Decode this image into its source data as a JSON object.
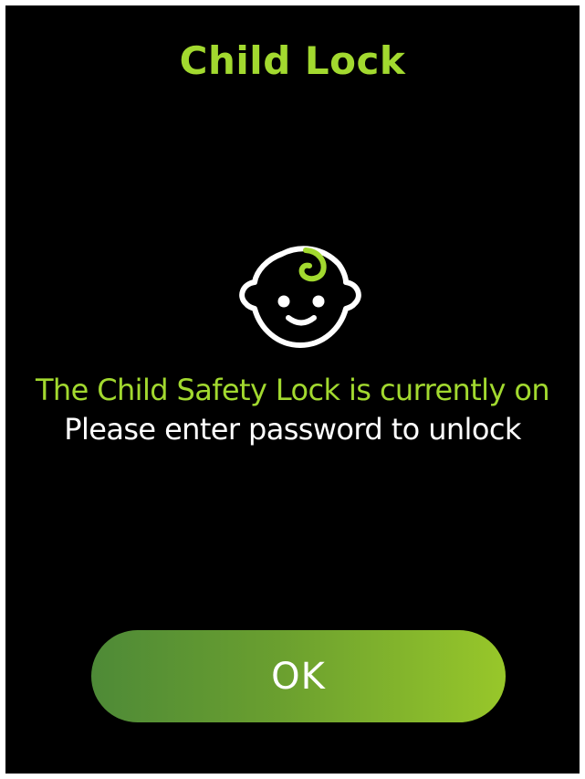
{
  "screen": {
    "title": "Child Lock",
    "status_text": "The Child Safety Lock is currently on",
    "prompt_text": "Please enter password to unlock",
    "ok_label": "OK",
    "icon": "baby-face-icon"
  },
  "colors": {
    "background": "#000000",
    "accent": "#a2d92f",
    "text": "#ffffff",
    "button_gradient_start": "#4e8a37",
    "button_gradient_end": "#98c72a"
  }
}
